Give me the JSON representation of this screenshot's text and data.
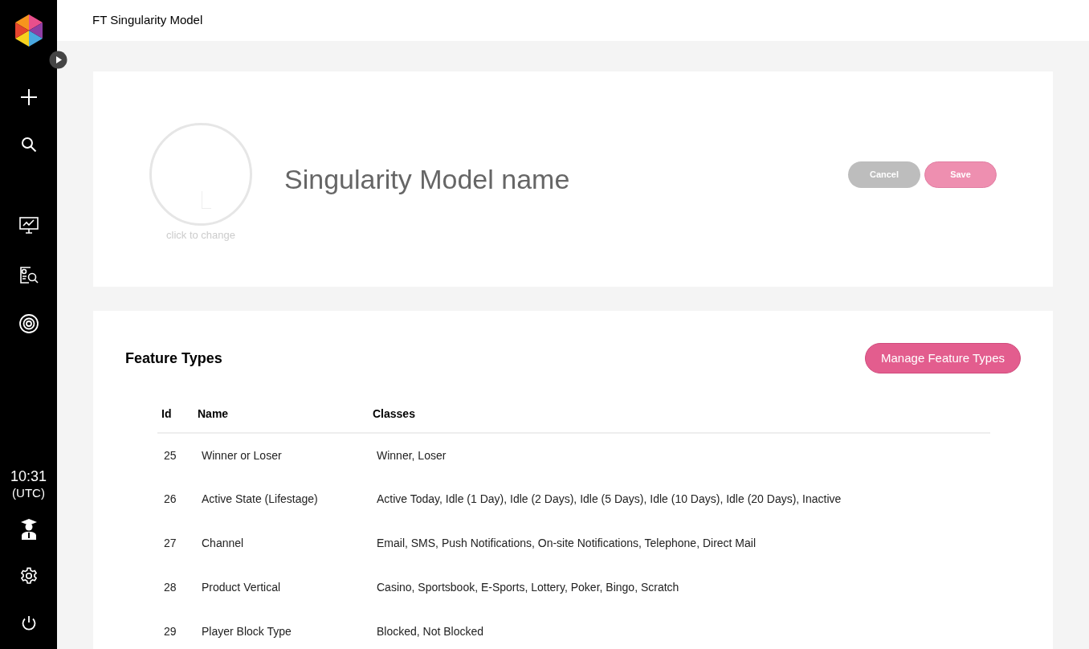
{
  "sidebar": {
    "clock": {
      "time": "10:31",
      "zone": "(UTC)"
    }
  },
  "header": {
    "title": "FT Singularity Model"
  },
  "model_card": {
    "avatar_hint": "click to change",
    "name_field": {
      "placeholder": "Singularity Model name"
    },
    "buttons": [
      {
        "label": "Cancel",
        "kind": "cancel",
        "disabled": false
      },
      {
        "label": "Save",
        "kind": "save",
        "disabled": true
      }
    ]
  },
  "feature_types": {
    "title": "Feature Types",
    "manage_button": "Manage Feature Types",
    "table": {
      "columns": [
        "Id",
        "Name",
        "Classes"
      ],
      "rows": [
        [
          "25",
          "Winner or Loser",
          "Winner, Loser"
        ],
        [
          "26",
          "Active State (Lifestage)",
          "Active Today, Idle (1 Day), Idle (2 Days), Idle (5 Days), Idle (10 Days), Idle (20 Days), Inactive"
        ],
        [
          "27",
          "Channel",
          "Email, SMS, Push Notifications, On-site Notifications, Telephone, Direct Mail"
        ],
        [
          "28",
          "Product Vertical",
          "Casino, Sportsbook, E-Sports, Lottery, Poker, Bingo, Scratch"
        ],
        [
          "29",
          "Player Block Type",
          "Blocked, Not Blocked"
        ]
      ]
    }
  }
}
